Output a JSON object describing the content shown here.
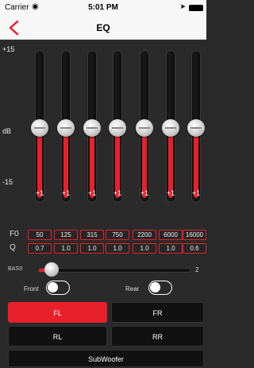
{
  "status_bar": {
    "carrier": "Carrier",
    "time": "5:01 PM"
  },
  "nav": {
    "title": "EQ"
  },
  "scale": {
    "top": "+15",
    "mid": "dB",
    "bottom": "-15"
  },
  "bands": [
    {
      "gain": "+1",
      "f0": "50",
      "q": "0.7"
    },
    {
      "gain": "+1",
      "f0": "125",
      "q": "1.0"
    },
    {
      "gain": "+1",
      "f0": "315",
      "q": "1.0"
    },
    {
      "gain": "+1",
      "f0": "750",
      "q": "1.0"
    },
    {
      "gain": "+1",
      "f0": "2200",
      "q": "1.0"
    },
    {
      "gain": "+1",
      "f0": "6000",
      "q": "1.0"
    },
    {
      "gain": "+1",
      "f0": "16000",
      "q": "0.6"
    }
  ],
  "labels": {
    "f0": "F0",
    "q": "Q"
  },
  "bass": {
    "label": "BASS",
    "value": "2"
  },
  "toggles": {
    "front": "Front",
    "rear": "Rear"
  },
  "channels": {
    "fl": "FL",
    "fr": "FR",
    "rl": "RL",
    "rr": "RR",
    "sub": "SubWoofer"
  },
  "colors": {
    "accent": "#e8202a"
  },
  "icons": {
    "back": "chevron-left-icon",
    "wifi": "wifi-icon",
    "location": "location-icon",
    "battery": "battery-icon"
  }
}
